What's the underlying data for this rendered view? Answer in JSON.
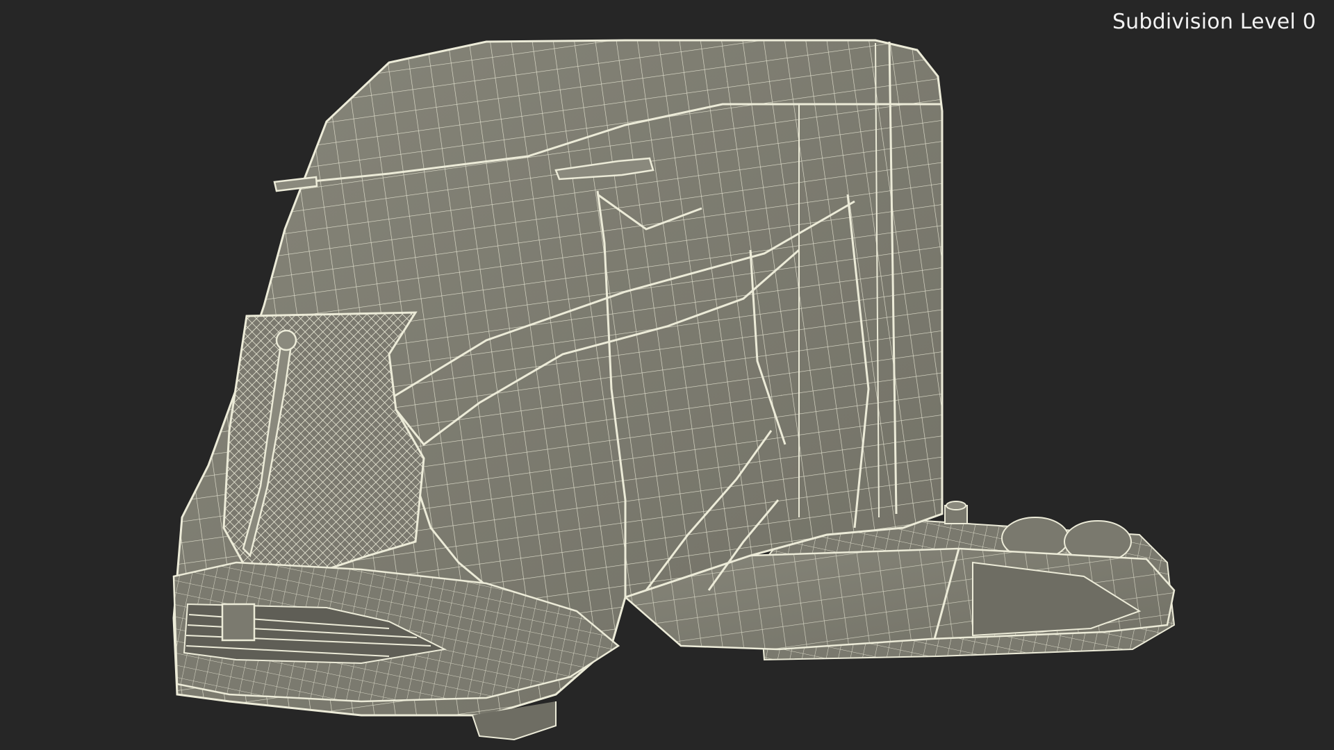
{
  "viewport": {
    "subdivision_label": "Subdivision Level 0",
    "background_color": "#262626",
    "model_surface_color": "#7e7d73",
    "wire_color": "#ecebd8",
    "model_icon": "wireframe-truck-cab"
  }
}
